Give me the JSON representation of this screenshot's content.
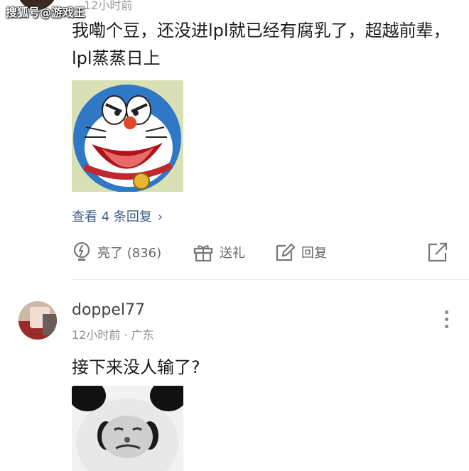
{
  "watermark": "搜狐号@游戏王",
  "comment1": {
    "time": "12小时前",
    "text": "我嘞个豆，还没进lpl就已经有腐乳了，超越前辈，lpl蒸蒸日上",
    "image_alt": "doraemon-sticker",
    "view_replies": "查看 4 条回复",
    "view_replies_chevron": "›",
    "actions": {
      "like": "亮了 (836)",
      "gift": "送礼",
      "reply": "回复"
    }
  },
  "comment2": {
    "username": "doppel77",
    "meta": "12小时前 · 广东",
    "text": "接下来没人输了?",
    "image_alt": "panda-meme-sticker"
  },
  "colors": {
    "link": "#3e5f8a",
    "action_gray": "#666666",
    "meta_gray": "#8d8d8d"
  }
}
